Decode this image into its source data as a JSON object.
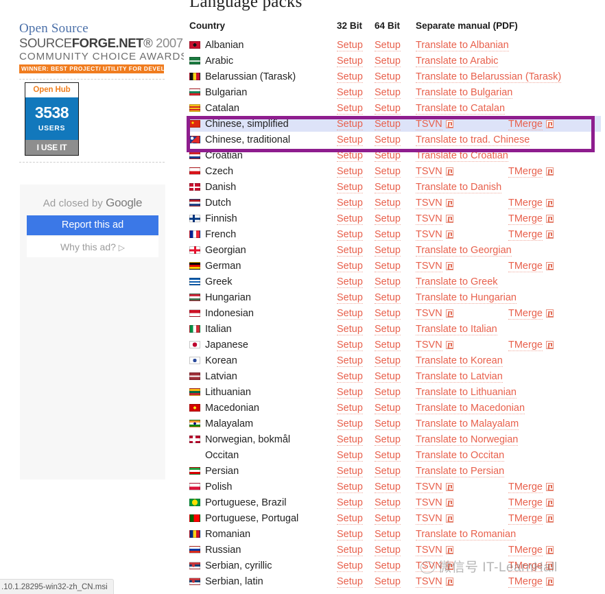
{
  "sidebar": {
    "award": {
      "line1": "Open Source",
      "line2_pre": "SOURCE",
      "line2_bold": "FORGE",
      "line2_post": ".NET",
      "line2_reg": "®",
      "line2_year": "2007",
      "line3": "COMMUNITY  CHOICE  AWARDS",
      "banner": "WINNER: BEST PROJECT/ UTILITY FOR DEVELOPERS"
    },
    "openhub": {
      "title": "Open Hub",
      "count": "3538",
      "unit": "USERS",
      "cta": "I USE IT"
    },
    "ad": {
      "closed_text_pre": "Ad closed by ",
      "closed_brand": "Google",
      "report_label": "Report this ad",
      "why_label": "Why this ad?",
      "why_glyph": "▷"
    }
  },
  "statusbar": {
    "text": ".10.1.28295-win32-zh_CN.msi"
  },
  "watermark": {
    "text": "微信号 IT-LearnHall",
    "icon": "wechat-smiley-icon"
  },
  "main": {
    "title": "Language packs",
    "columns": {
      "country": "Country",
      "bit32": "32 Bit",
      "bit64": "64 Bit",
      "manual": "Separate manual (PDF)"
    },
    "setup_label": "Setup",
    "highlight_color": "#8e1d8e",
    "link_color": "#e8604c",
    "selected_row_bg": "#dde3f8",
    "rows": [
      {
        "country": "Albanian",
        "flag": "al",
        "b32": "Setup",
        "b64": "Setup",
        "manual": "Translate to Albanian",
        "manual2": "",
        "pdf1": false,
        "pdf2": false
      },
      {
        "country": "Arabic",
        "flag": "sa",
        "b32": "Setup",
        "b64": "Setup",
        "manual": "Translate to Arabic",
        "manual2": "",
        "pdf1": false,
        "pdf2": false
      },
      {
        "country": "Belarussian (Tarask)",
        "flag": "by",
        "b32": "Setup",
        "b64": "Setup",
        "manual": "Translate to Belarussian (Tarask)",
        "manual2": "",
        "pdf1": false,
        "pdf2": false
      },
      {
        "country": "Bulgarian",
        "flag": "bg",
        "b32": "Setup",
        "b64": "Setup",
        "manual": "Translate to Bulgarian",
        "manual2": "",
        "pdf1": false,
        "pdf2": false
      },
      {
        "country": "Catalan",
        "flag": "ct",
        "b32": "Setup",
        "b64": "Setup",
        "manual": "Translate to Catalan",
        "manual2": "",
        "pdf1": false,
        "pdf2": false
      },
      {
        "country": "Chinese, simplified",
        "flag": "cn",
        "b32": "Setup",
        "b64": "Setup",
        "manual": "TSVN",
        "manual2": "TMerge",
        "pdf1": true,
        "pdf2": true,
        "selected": true
      },
      {
        "country": "Chinese, traditional",
        "flag": "tw",
        "b32": "Setup",
        "b64": "Setup",
        "manual": "Translate to trad. Chinese",
        "manual2": "",
        "pdf1": false,
        "pdf2": false
      },
      {
        "country": "Croatian",
        "flag": "hr",
        "b32": "Setup",
        "b64": "Setup",
        "manual": "Translate to Croatian",
        "manual2": "",
        "pdf1": false,
        "pdf2": false
      },
      {
        "country": "Czech",
        "flag": "cz",
        "b32": "Setup",
        "b64": "Setup",
        "manual": "TSVN",
        "manual2": "TMerge",
        "pdf1": true,
        "pdf2": true
      },
      {
        "country": "Danish",
        "flag": "dk",
        "b32": "Setup",
        "b64": "Setup",
        "manual": "Translate to Danish",
        "manual2": "",
        "pdf1": false,
        "pdf2": false
      },
      {
        "country": "Dutch",
        "flag": "nl",
        "b32": "Setup",
        "b64": "Setup",
        "manual": "TSVN",
        "manual2": "TMerge",
        "pdf1": true,
        "pdf2": true
      },
      {
        "country": "Finnish",
        "flag": "fi",
        "b32": "Setup",
        "b64": "Setup",
        "manual": "TSVN",
        "manual2": "TMerge",
        "pdf1": true,
        "pdf2": true
      },
      {
        "country": "French",
        "flag": "fr",
        "b32": "Setup",
        "b64": "Setup",
        "manual": "TSVN",
        "manual2": "TMerge",
        "pdf1": true,
        "pdf2": true
      },
      {
        "country": "Georgian",
        "flag": "ge",
        "b32": "Setup",
        "b64": "Setup",
        "manual": "Translate to Georgian",
        "manual2": "",
        "pdf1": false,
        "pdf2": false
      },
      {
        "country": "German",
        "flag": "de",
        "b32": "Setup",
        "b64": "Setup",
        "manual": "TSVN",
        "manual2": "TMerge",
        "pdf1": true,
        "pdf2": true
      },
      {
        "country": "Greek",
        "flag": "gr",
        "b32": "Setup",
        "b64": "Setup",
        "manual": "Translate to Greek",
        "manual2": "",
        "pdf1": false,
        "pdf2": false
      },
      {
        "country": "Hungarian",
        "flag": "hu",
        "b32": "Setup",
        "b64": "Setup",
        "manual": "Translate to Hungarian",
        "manual2": "",
        "pdf1": false,
        "pdf2": false
      },
      {
        "country": "Indonesian",
        "flag": "id",
        "b32": "Setup",
        "b64": "Setup",
        "manual": "TSVN",
        "manual2": "TMerge",
        "pdf1": true,
        "pdf2": true
      },
      {
        "country": "Italian",
        "flag": "it",
        "b32": "Setup",
        "b64": "Setup",
        "manual": "Translate to Italian",
        "manual2": "",
        "pdf1": false,
        "pdf2": false
      },
      {
        "country": "Japanese",
        "flag": "jp",
        "b32": "Setup",
        "b64": "Setup",
        "manual": "TSVN",
        "manual2": "TMerge",
        "pdf1": true,
        "pdf2": true
      },
      {
        "country": "Korean",
        "flag": "kr",
        "b32": "Setup",
        "b64": "Setup",
        "manual": "Translate to Korean",
        "manual2": "",
        "pdf1": false,
        "pdf2": false
      },
      {
        "country": "Latvian",
        "flag": "lv",
        "b32": "Setup",
        "b64": "Setup",
        "manual": "Translate to Latvian",
        "manual2": "",
        "pdf1": false,
        "pdf2": false
      },
      {
        "country": "Lithuanian",
        "flag": "lt",
        "b32": "Setup",
        "b64": "Setup",
        "manual": "Translate to Lithuanian",
        "manual2": "",
        "pdf1": false,
        "pdf2": false
      },
      {
        "country": "Macedonian",
        "flag": "mk",
        "b32": "Setup",
        "b64": "Setup",
        "manual": "Translate to Macedonian",
        "manual2": "",
        "pdf1": false,
        "pdf2": false
      },
      {
        "country": "Malayalam",
        "flag": "in",
        "b32": "Setup",
        "b64": "Setup",
        "manual": "Translate to Malayalam",
        "manual2": "",
        "pdf1": false,
        "pdf2": false
      },
      {
        "country": "Norwegian, bokmål",
        "flag": "no",
        "b32": "Setup",
        "b64": "Setup",
        "manual": "Translate to Norwegian",
        "manual2": "",
        "pdf1": false,
        "pdf2": false
      },
      {
        "country": "Occitan",
        "flag": "none",
        "b32": "Setup",
        "b64": "Setup",
        "manual": "Translate to Occitan",
        "manual2": "",
        "pdf1": false,
        "pdf2": false
      },
      {
        "country": "Persian",
        "flag": "ir",
        "b32": "Setup",
        "b64": "Setup",
        "manual": "Translate to Persian",
        "manual2": "",
        "pdf1": false,
        "pdf2": false
      },
      {
        "country": "Polish",
        "flag": "pl",
        "b32": "Setup",
        "b64": "Setup",
        "manual": "TSVN",
        "manual2": "TMerge",
        "pdf1": true,
        "pdf2": true
      },
      {
        "country": "Portuguese, Brazil",
        "flag": "br",
        "b32": "Setup",
        "b64": "Setup",
        "manual": "TSVN",
        "manual2": "TMerge",
        "pdf1": true,
        "pdf2": true
      },
      {
        "country": "Portuguese, Portugal",
        "flag": "pt",
        "b32": "Setup",
        "b64": "Setup",
        "manual": "TSVN",
        "manual2": "TMerge",
        "pdf1": true,
        "pdf2": true
      },
      {
        "country": "Romanian",
        "flag": "ro",
        "b32": "Setup",
        "b64": "Setup",
        "manual": "Translate to Romanian",
        "manual2": "",
        "pdf1": false,
        "pdf2": false
      },
      {
        "country": "Russian",
        "flag": "ru",
        "b32": "Setup",
        "b64": "Setup",
        "manual": "TSVN",
        "manual2": "TMerge",
        "pdf1": true,
        "pdf2": true
      },
      {
        "country": "Serbian, cyrillic",
        "flag": "rs",
        "b32": "Setup",
        "b64": "Setup",
        "manual": "TSVN",
        "manual2": "TMerge",
        "pdf1": true,
        "pdf2": true
      },
      {
        "country": "Serbian, latin",
        "flag": "rs",
        "b32": "Setup",
        "b64": "Setup",
        "manual": "TSVN",
        "manual2": "TMerge",
        "pdf1": true,
        "pdf2": true
      }
    ]
  }
}
